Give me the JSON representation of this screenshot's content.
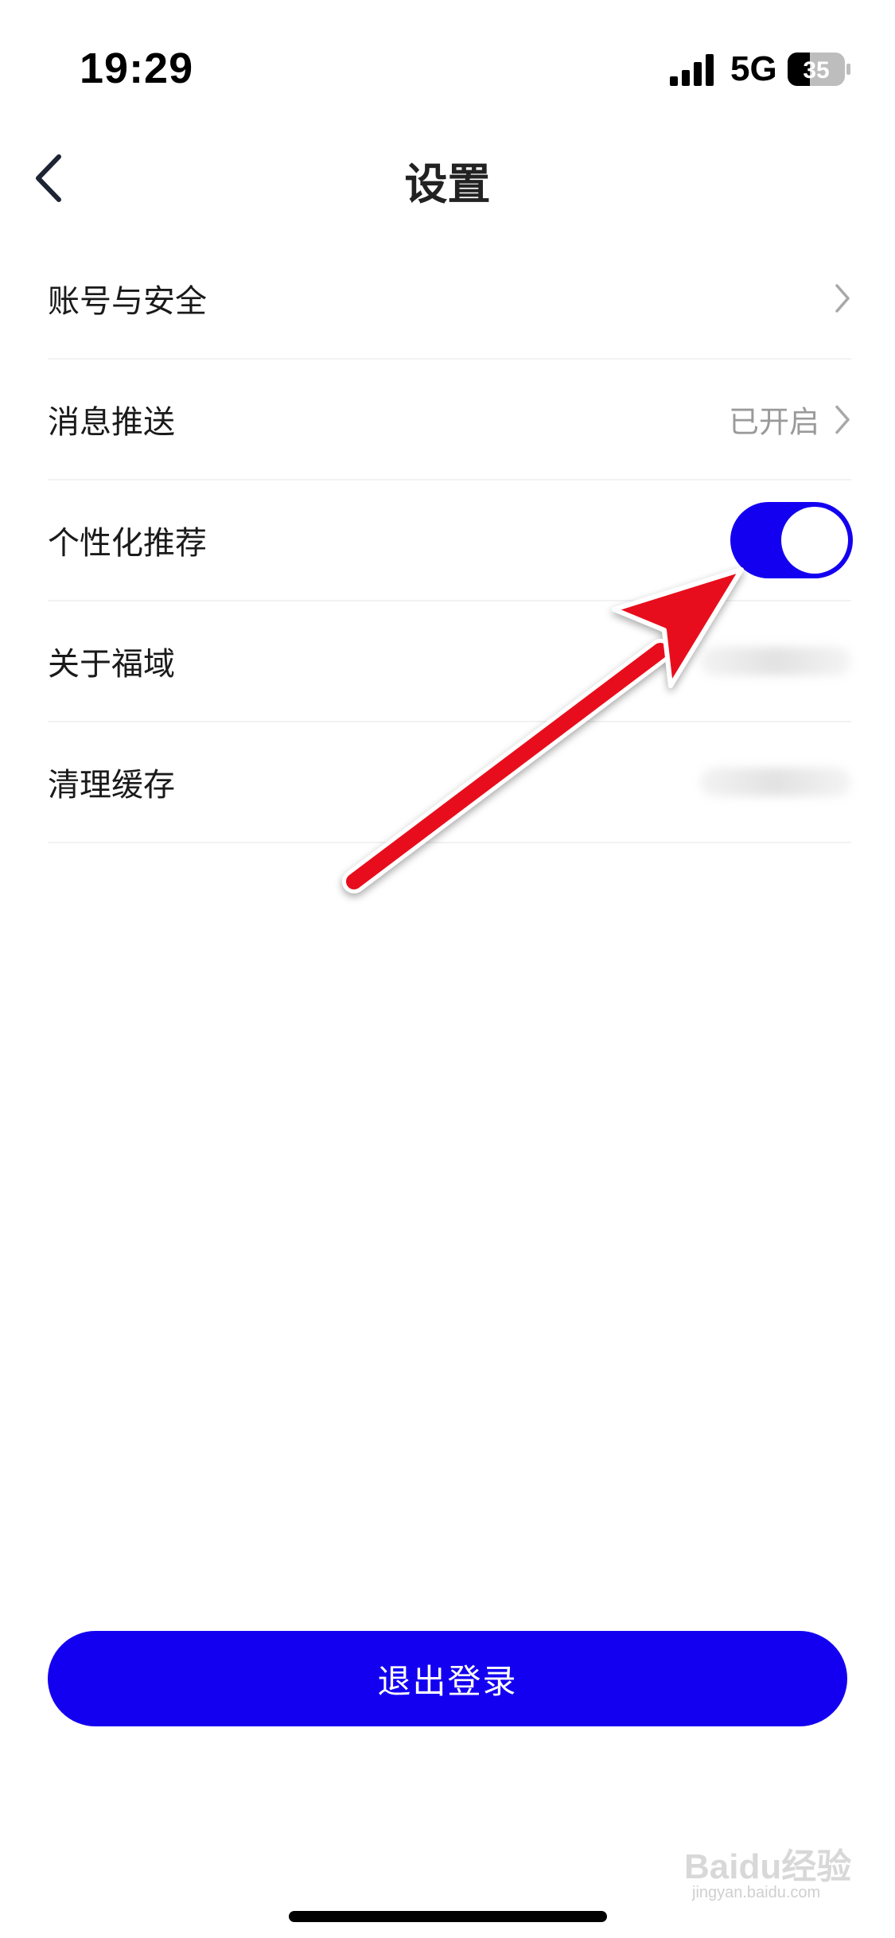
{
  "status_bar": {
    "time": "19:29",
    "network": "5G",
    "battery": "35"
  },
  "nav": {
    "title": "设置",
    "back_icon": "chevron-left-icon"
  },
  "settings": {
    "items": [
      {
        "label": "账号与安全",
        "value": "",
        "accessory": "chevron"
      },
      {
        "label": "消息推送",
        "value": "已开启",
        "accessory": "chevron"
      },
      {
        "label": "个性化推荐",
        "value": "",
        "accessory": "toggle",
        "toggle_on": true
      },
      {
        "label": "关于福域",
        "value": "",
        "accessory": "blurred"
      },
      {
        "label": "清理缓存",
        "value": "",
        "accessory": "blurred"
      }
    ]
  },
  "logout": {
    "label": "退出登录"
  },
  "watermark": {
    "main": "Baidu经验",
    "sub": "jingyan.baidu.com"
  },
  "colors": {
    "accent": "#1400f0",
    "annotation_arrow": "#e8101b"
  }
}
